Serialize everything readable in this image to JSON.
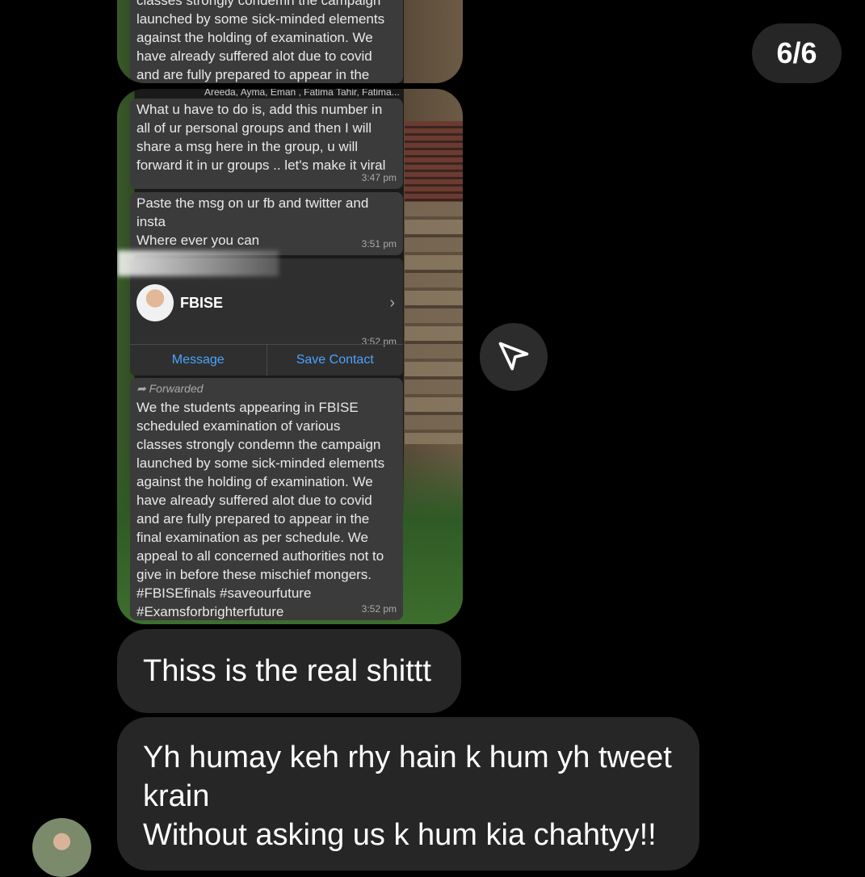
{
  "counter": "6/6",
  "screenshot_top": {
    "text": "classes strongly condemn the campaign\nlaunched by some sick-minded elements\nagainst the holding of examination. We\nhave already suffered alot due to covid\nand are fully prepared to appear in the"
  },
  "screenshot_main": {
    "group_members": "Areeda, Ayma, Eman , Fatima Tahir, Fatima...",
    "msg1": {
      "text": "What u have to do is, add this number in\nall of ur personal groups and then I will\nshare a msg here in the group, u will\nforward it in ur groups .. let's make it viral",
      "time": "3:47 pm"
    },
    "msg2": {
      "text": "Paste the msg on ur fb and twitter and\ninsta\nWhere ever you can",
      "time": "3:51 pm"
    },
    "contact": {
      "name": "FBISE",
      "time": "3:52 pm",
      "message_btn": "Message",
      "save_btn": "Save Contact"
    },
    "msg3": {
      "forwarded_label": "Forwarded",
      "text": "We the students appearing in FBISE\nscheduled examination of various\nclasses strongly condemn the campaign\nlaunched by some sick-minded elements\nagainst the holding of examination. We\nhave already suffered alot due to covid\nand are fully prepared to appear in the\nfinal examination as per schedule. We\nappeal to all concerned authorities not to\ngive in before these mischief mongers.\n#FBISEfinals #saveourfuture\n#Examsforbrighterfuture",
      "time": "3:52 pm"
    }
  },
  "dm": {
    "message1": "Thiss is the real shittt",
    "message2": "Yh humay keh rhy hain k hum yh tweet\nkrain\nWithout asking us k hum kia chahtyy!!"
  },
  "icons": {
    "share": "paper-plane-icon",
    "forward": "forward-arrow-icon"
  }
}
